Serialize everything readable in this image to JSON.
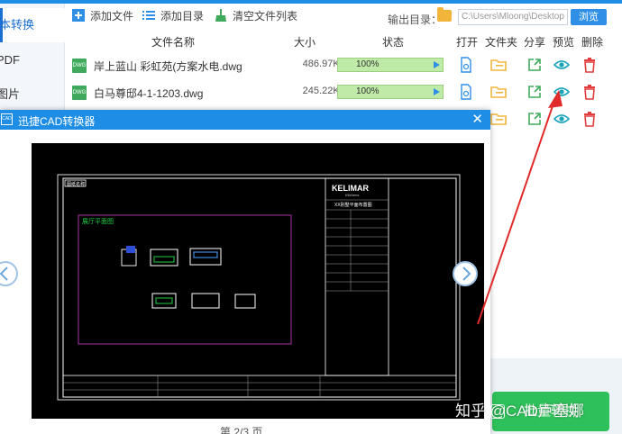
{
  "sidebar": {
    "items": [
      {
        "label": "本转换",
        "active": true
      },
      {
        "label": "PDF",
        "active": false
      },
      {
        "label": "图片",
        "active": false
      }
    ]
  },
  "toolbar": {
    "add_file": "添加文件",
    "add_folder": "添加目录",
    "clear_list": "清空文件列表",
    "output_label": "输出目录：",
    "output_path": "C:\\Users\\Mloong\\Desktop",
    "browse": "浏览"
  },
  "table": {
    "headers": {
      "name": "文件名称",
      "size": "大小",
      "status": "状态",
      "open": "打开",
      "folder": "文件夹",
      "share": "分享",
      "preview": "预览",
      "delete": "删除"
    },
    "rows": [
      {
        "icon": "DWG",
        "name": "岸上蓝山 彩虹苑(方案水电.dwg",
        "size": "486.97KB",
        "progress": "100%"
      },
      {
        "icon": "DWG",
        "name": "白马尊邸4-1-1203.dwg",
        "size": "245.22KB",
        "progress": "100%"
      }
    ]
  },
  "dialog": {
    "logo": "CAD",
    "title": "迅捷CAD转换器",
    "page_indicator": "第 2/3 页",
    "drawing": {
      "frame_label": "图纸名称",
      "layout_title": "展厅平面图",
      "brand": "KELIMAR",
      "brand_sub": "Kitchens",
      "project": "XX别墅平面布置图"
    }
  },
  "convert_button": "批量转换",
  "watermark": "知乎 @CAD卢塞娜",
  "colors": {
    "accent": "#1e8de6",
    "progress_fill": "#bfeaa8",
    "success": "#2ec05a",
    "delete": "#e23d3d",
    "preview_eye": "#19a3b8",
    "drawing_frame": "#8a2b8a",
    "drawing_label": "#22d045"
  }
}
